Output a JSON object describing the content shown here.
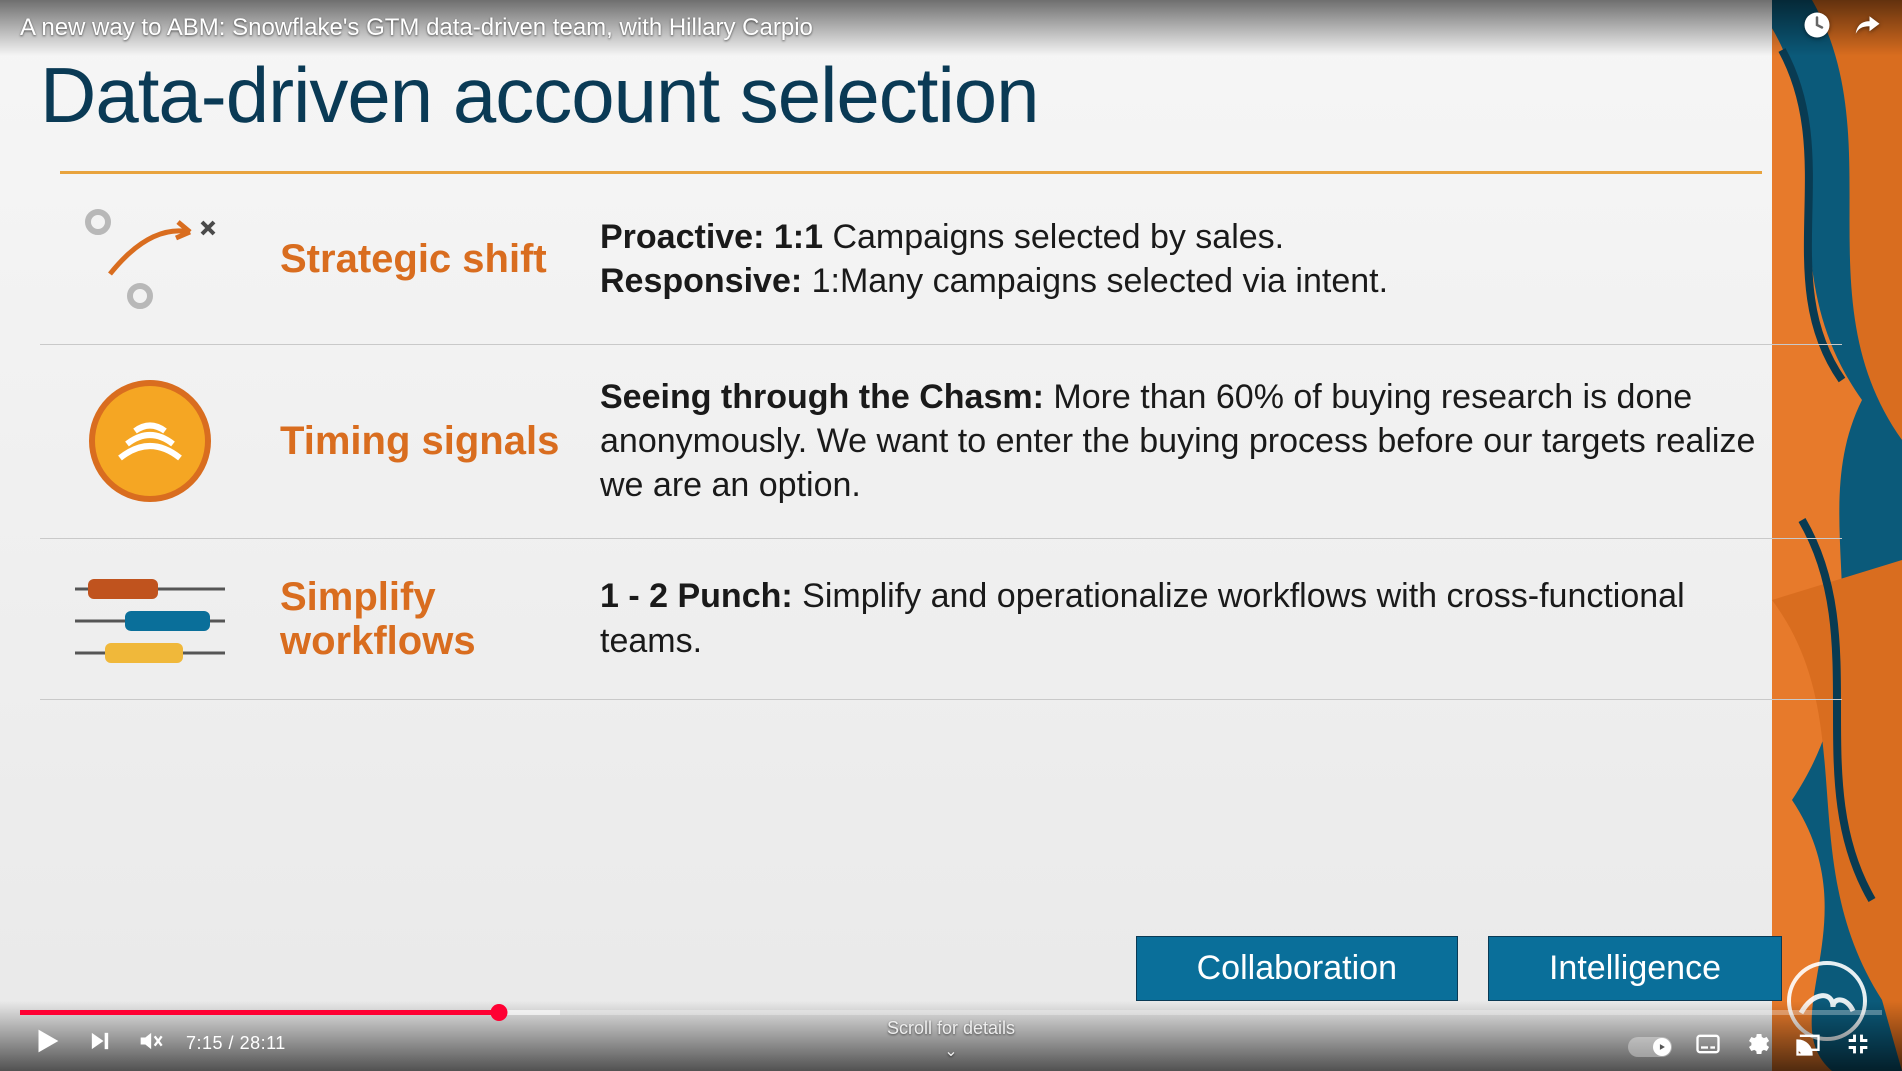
{
  "video": {
    "title": "A new way to ABM: Snowflake's GTM data-driven team, with Hillary Carpio",
    "current_time": "7:15",
    "duration": "28:11",
    "scroll_hint": "Scroll for details"
  },
  "slide": {
    "title": "Data-driven account selection",
    "rows": [
      {
        "label": "Strategic shift",
        "body_lead1": "Proactive: 1:1",
        "body_tail1": " Campaigns selected by sales.",
        "body_lead2": "Responsive:",
        "body_tail2": " 1:Many campaigns selected via intent."
      },
      {
        "label": "Timing signals",
        "body_lead1": "Seeing through the Chasm:",
        "body_tail1": " More than 60% of buying research is done anonymously. We want to enter the buying process before our targets realize we are an option."
      },
      {
        "label": "Simplify workflows",
        "body_lead1": "1 - 2 Punch:",
        "body_tail1": " Simplify and operationalize workflows with cross-functional teams."
      }
    ],
    "tags": [
      "Collaboration",
      "Intelligence"
    ]
  }
}
